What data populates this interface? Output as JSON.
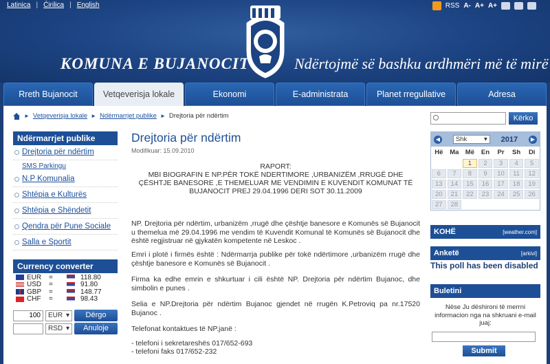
{
  "header": {
    "languages": [
      "Latinica",
      "Ćirilica",
      "English"
    ],
    "rss_label": "RSS",
    "font_controls": [
      "A-",
      "A+",
      "A+"
    ],
    "title_left": "KOMUNA E BUJANOCIT",
    "title_right": "Ndërtojmë së bashku ardhmëri më të mirë",
    "crest_icon": "municipal-crest"
  },
  "nav": {
    "tabs": [
      "Rreth Bujanocit",
      "Vetqeverisja lokale",
      "Ekonomi",
      "E-administrata",
      "Planet rregullative",
      "Adresa"
    ],
    "active_index": 1
  },
  "breadcrumb": {
    "items": [
      "Vetqeverisja lokale",
      "Ndërmarrjet publike",
      "Drejtoria për ndërtim"
    ]
  },
  "left_sidebar": {
    "heading": "Ndërmarrjet publike",
    "items": [
      {
        "label": "Drejtoria për ndërtim",
        "sub": false
      },
      {
        "label": "SMS Parkingu",
        "sub": true
      },
      {
        "label": "N.P Komunalia",
        "sub": false
      },
      {
        "label": "Shtëpia e Kulturës",
        "sub": false
      },
      {
        "label": "Shtëpia e Shëndetit",
        "sub": false
      },
      {
        "label": "Qendra për Pune Sociale",
        "sub": false
      },
      {
        "label": "Salla e Sportit",
        "sub": false
      }
    ],
    "currency": {
      "heading": "Currency converter",
      "rates": [
        {
          "code": "EUR",
          "eq": "=",
          "value": "118.80"
        },
        {
          "code": "USD",
          "eq": "=",
          "value": "91.80"
        },
        {
          "code": "GBP",
          "eq": "=",
          "value": "148.77"
        },
        {
          "code": "CHF",
          "eq": "=",
          "value": "98.43"
        }
      ],
      "amount_value": "100",
      "from_currency": "EUR",
      "to_currency": "RSD",
      "convert_label": "Dërgo",
      "cancel_label": "Anuloje"
    }
  },
  "main": {
    "title": "Drejtoria për ndërtim",
    "modified": "Modifikuar: 15.09.2010",
    "raport_title": "RAPORT:",
    "raport_text": "MBI BIOGRAFIN E NP.PËR TOKË NDERTIMORE ,URBANIZËM ,RRUGË DHE ÇËSHTJE BANESORE ,E THEMELUAR ME VENDIMIN E KUVENDIT KOMUNAT TË BUJANOCIT PREJ 29.04.1996 DERI SOT 30.11.2009",
    "paragraphs": [
      "NP. Drejtoria për ndërtim, urbanizëm ,rrugë dhe çështje banesore e Komunës së Bujanocit u themelua më 29.04.1996 me vendim të Kuvendit Komunal të Komunës së Bujanocit dhe është regjistruar në gjykatën kompetente në Leskoc .",
      "Emri i plotë i firmës është : Ndërmarrja publike për tokë ndërtimore ,urbanizëm rrugë dhe çështje banesore e Komunës së Bujanocit .",
      "Firma ka edhe emrin e shkurtuar i cili është NP. Drejtoria për ndërtim Bujanoc, dhe simbolin e punes .",
      "Selia e NP.Drejtoria për ndërtim Bujanoc gjendet në rrugën K.Petroviq pa nr.17520 Bujanoc .",
      "Telefonat kontaktues të NP.janë :",
      "- telefoni i sekretareshës 017/652-693",
      "- telefoni faks 017/652-232"
    ]
  },
  "right_sidebar": {
    "search_button": "Kërko",
    "calendar": {
      "month": "Shk",
      "year": "2017",
      "weekdays": [
        "Hë",
        "Ma",
        "Më",
        "En",
        "Pr",
        "Sh",
        "Di"
      ],
      "weeks": [
        [
          "",
          "",
          "1",
          "2",
          "3",
          "4",
          "5"
        ],
        [
          "6",
          "7",
          "8",
          "9",
          "10",
          "11",
          "12"
        ],
        [
          "13",
          "14",
          "15",
          "16",
          "17",
          "18",
          "19"
        ],
        [
          "20",
          "21",
          "22",
          "23",
          "24",
          "25",
          "26"
        ],
        [
          "27",
          "28",
          "",
          "",
          "",
          "",
          ""
        ]
      ],
      "today": "1"
    },
    "weather_heading": "KOHË",
    "weather_link": "[weather.com]",
    "poll_heading": "Anketë",
    "poll_archive": "[arkivi]",
    "poll_message": "This poll has been disabled",
    "newsletter_heading": "Buletini",
    "newsletter_text": "Nëse Ju dëshironi të merrni informacion nga na shkruani e-mail juaj:",
    "submit_label": "Submit"
  },
  "colors": {
    "brand_blue": "#1d4f96",
    "header_bg": "#1c4382",
    "active_tab": "#e9eef5"
  }
}
